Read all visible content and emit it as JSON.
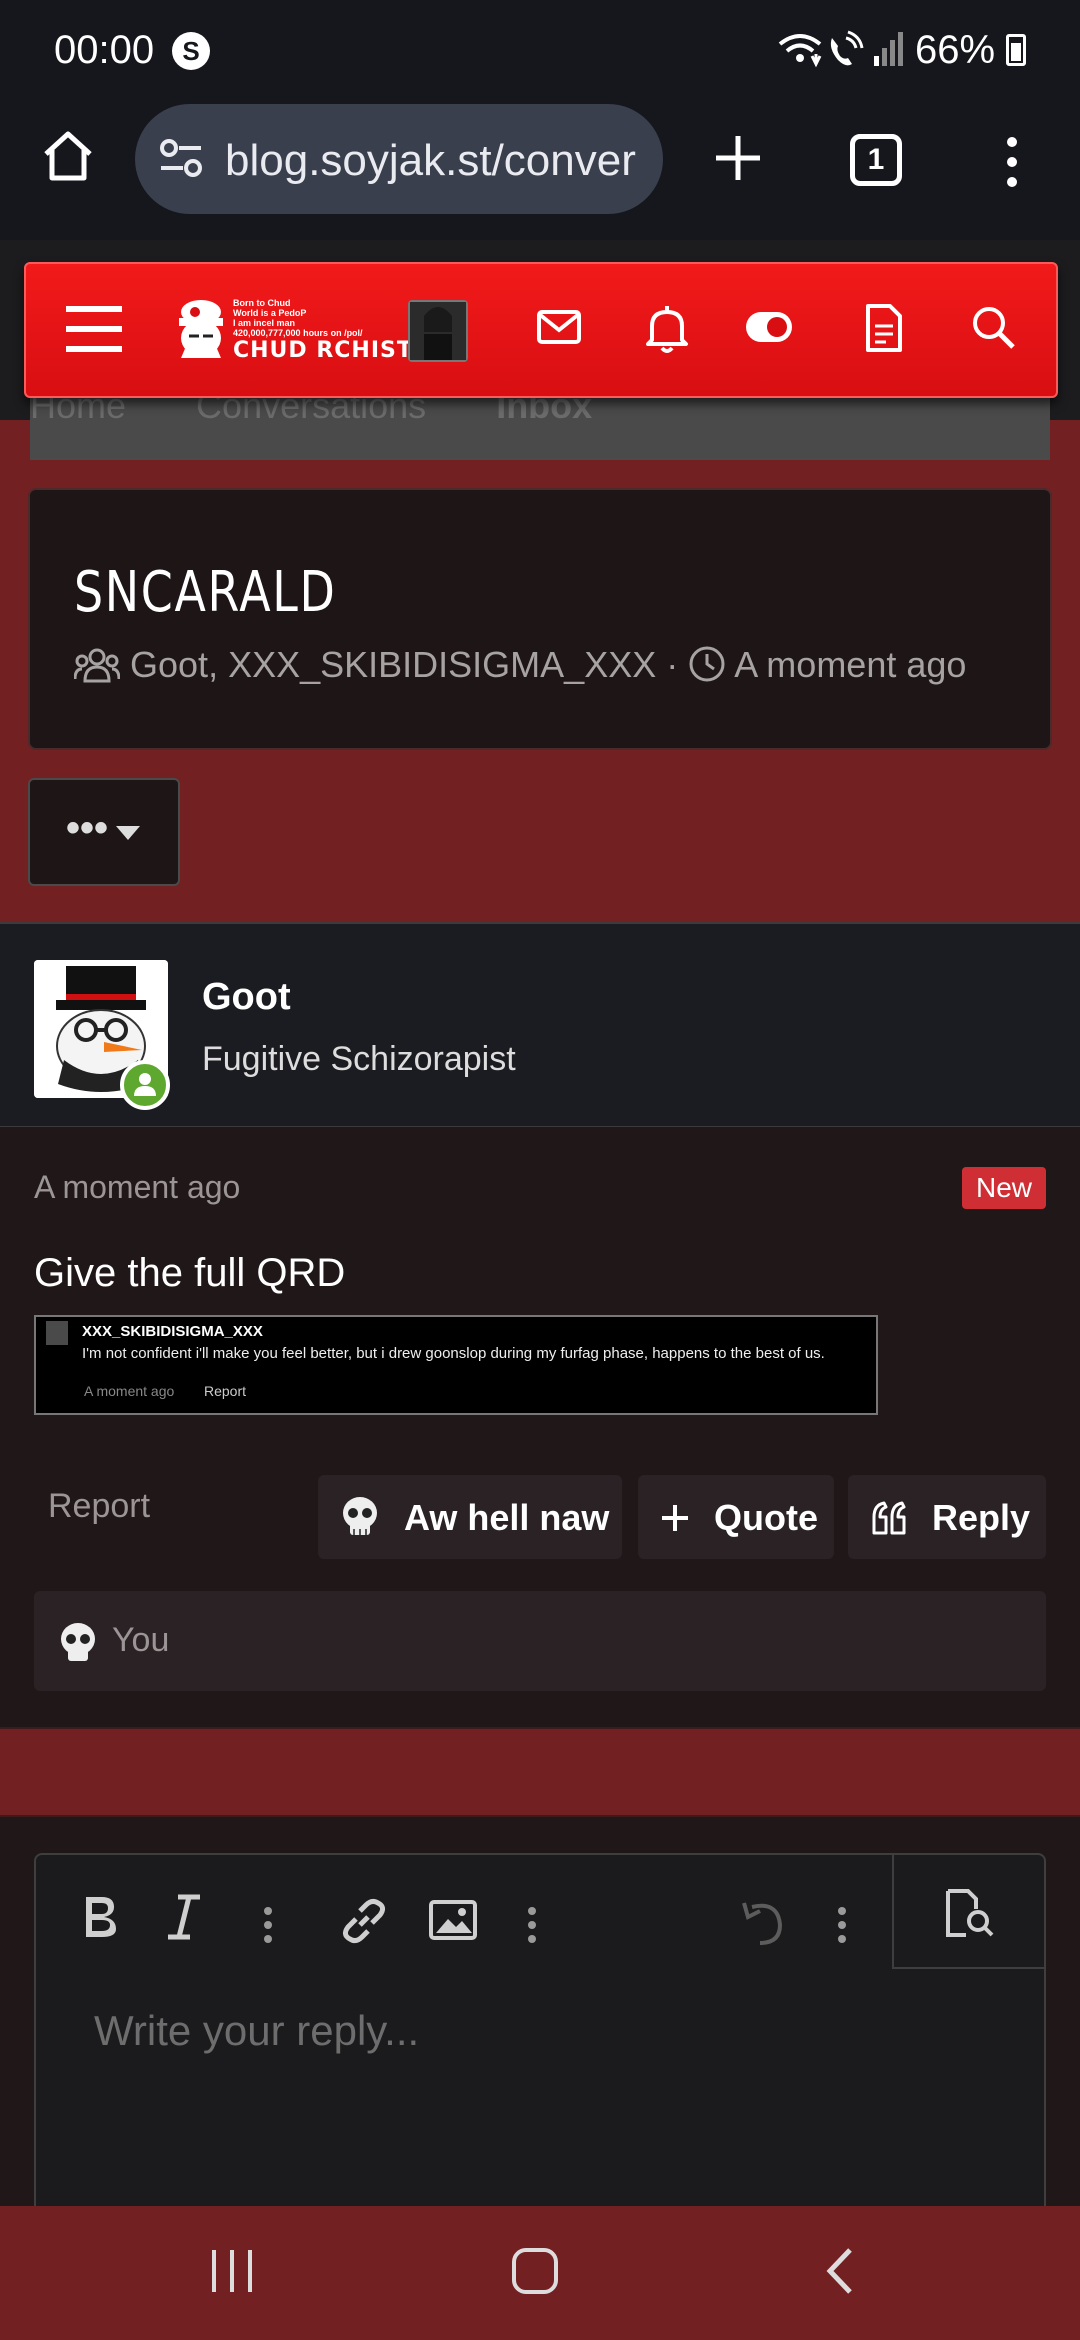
{
  "status_bar": {
    "time": "00:00",
    "battery": "66%"
  },
  "browser": {
    "url": "blog.soyjak.st/conver",
    "tab_count": "1"
  },
  "site": {
    "logo_small_lines": [
      "Born to Chud",
      "World is a PedoP",
      "I am incel man",
      "420,000,777,000 hours on /pol/"
    ],
    "logo_main": "CHUD RCHIST",
    "breadcrumbs": [
      "Home",
      "Conversations",
      "Inbox"
    ]
  },
  "conversation": {
    "title": "SNCARALD",
    "participants": "Goot, XXX_SKIBIDISIGMA_XXX",
    "separator": "·",
    "time": "A moment ago",
    "more_label": "•••"
  },
  "message": {
    "author": "Goot",
    "role": "Fugitive Schizorapist",
    "time": "A moment ago",
    "new_badge": "New",
    "text": "Give the full QRD",
    "quote": {
      "name": "XXX_SKIBIDISIGMA_XXX",
      "text": "I'm not confident i'll make you feel better, but i drew goonslop during my furfag phase, happens to the best of us.",
      "time": "A moment ago",
      "report": "Report"
    },
    "report_label": "Report",
    "actions": {
      "react": "Aw hell naw",
      "quote": "Quote",
      "reply": "Reply"
    },
    "reactions_label": "You"
  },
  "editor": {
    "placeholder": "Write your reply..."
  }
}
